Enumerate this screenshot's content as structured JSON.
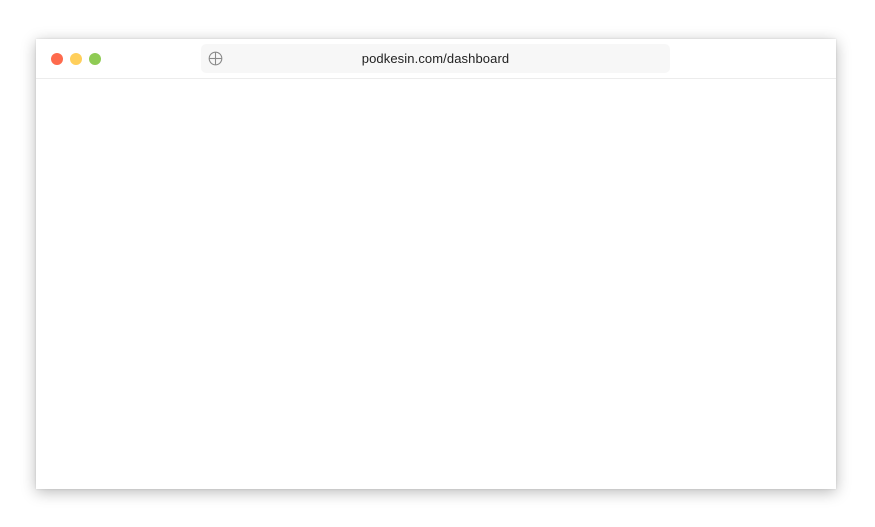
{
  "window": {
    "controls": {
      "close_color": "#fe6a4d",
      "minimize_color": "#ffcf5b",
      "maximize_color": "#8fcb54"
    },
    "address_bar": {
      "icon": "globe-icon",
      "url": "podkesin.com/dashboard"
    }
  }
}
